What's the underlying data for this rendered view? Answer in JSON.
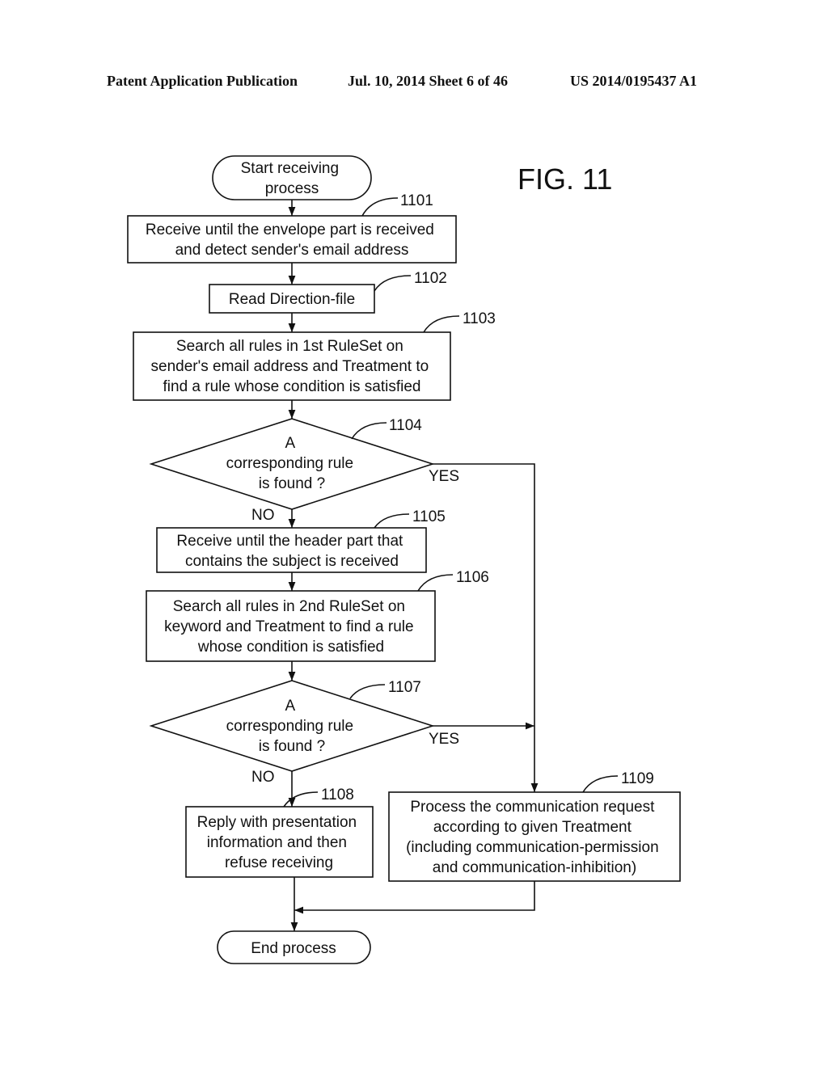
{
  "header": {
    "publication": "Patent Application Publication",
    "date_sheet": "Jul. 10, 2014   Sheet 6 of 46",
    "number": "US 2014/0195437 A1"
  },
  "figure_label": "FIG. 11",
  "nodes": {
    "start": {
      "type": "terminal",
      "lines": [
        "Start receiving",
        "process"
      ]
    },
    "n1101": {
      "ref": "1101",
      "type": "process",
      "lines": [
        "Receive until the envelope part is received",
        "and detect sender's email address"
      ]
    },
    "n1102": {
      "ref": "1102",
      "type": "process",
      "lines": [
        "Read Direction-file"
      ]
    },
    "n1103": {
      "ref": "1103",
      "type": "process",
      "lines": [
        "Search all rules in 1st RuleSet on",
        "sender's email address and Treatment to",
        "find a rule whose condition is satisfied"
      ]
    },
    "n1104": {
      "ref": "1104",
      "type": "decision",
      "lines": [
        "A",
        "corresponding rule",
        "is found ?"
      ]
    },
    "n1105": {
      "ref": "1105",
      "type": "process",
      "lines": [
        "Receive until the header part that",
        "contains the subject is received"
      ]
    },
    "n1106": {
      "ref": "1106",
      "type": "process",
      "lines": [
        "Search all rules in 2nd RuleSet on",
        "keyword and Treatment to find a rule",
        "whose condition is satisfied"
      ]
    },
    "n1107": {
      "ref": "1107",
      "type": "decision",
      "lines": [
        "A",
        "corresponding rule",
        "is found ?"
      ]
    },
    "n1108": {
      "ref": "1108",
      "type": "process",
      "lines": [
        "Reply with presentation",
        "information and then",
        "refuse receiving"
      ]
    },
    "n1109": {
      "ref": "1109",
      "type": "process",
      "lines": [
        "Process the communication request",
        "according to given Treatment",
        "(including communication-permission",
        "and communication-inhibition)"
      ]
    },
    "end": {
      "type": "terminal",
      "lines": [
        "End process"
      ]
    }
  },
  "edge_labels": {
    "yes": "YES",
    "no": "NO"
  },
  "edges": [
    {
      "from": "start",
      "to": "n1101"
    },
    {
      "from": "n1101",
      "to": "n1102"
    },
    {
      "from": "n1102",
      "to": "n1103"
    },
    {
      "from": "n1103",
      "to": "n1104"
    },
    {
      "from": "n1104",
      "to": "n1105",
      "label": "NO"
    },
    {
      "from": "n1104",
      "to": "n1109",
      "label": "YES"
    },
    {
      "from": "n1105",
      "to": "n1106"
    },
    {
      "from": "n1106",
      "to": "n1107"
    },
    {
      "from": "n1107",
      "to": "n1108",
      "label": "NO"
    },
    {
      "from": "n1107",
      "to": "n1109",
      "label": "YES"
    },
    {
      "from": "n1108",
      "to": "end"
    },
    {
      "from": "n1109",
      "to": "end"
    }
  ]
}
